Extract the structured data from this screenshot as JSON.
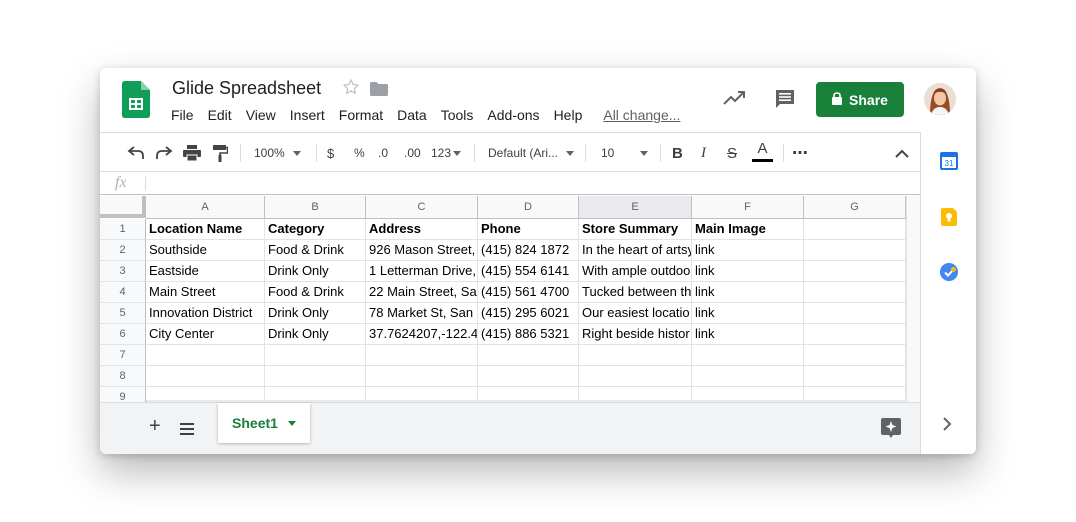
{
  "header": {
    "title": "Glide Spreadsheet",
    "share_label": "Share"
  },
  "menu": {
    "items": [
      "File",
      "Edit",
      "View",
      "Insert",
      "Format",
      "Data",
      "Tools",
      "Add-ons",
      "Help"
    ],
    "last_edit_link": "All change..."
  },
  "toolbar": {
    "zoom": "100%",
    "currency": "$",
    "percent": "%",
    "decrease_decimal": ".0",
    "increase_decimal": ".00",
    "more_formats": "123",
    "font": "Default (Ari...",
    "font_size": "10",
    "bold": "B",
    "italic": "I",
    "strike": "S",
    "text_color": "A",
    "more": "⋯"
  },
  "formula_bar": {
    "fx": "fx"
  },
  "sheet": {
    "columns": [
      "A",
      "B",
      "C",
      "D",
      "E",
      "F",
      "G"
    ],
    "selected_column": "E",
    "row_numbers": [
      "1",
      "2",
      "3",
      "4",
      "5",
      "6",
      "7",
      "8",
      "9"
    ],
    "rows": [
      [
        "Location Name",
        "Category",
        "Address",
        "Phone",
        "Store Summary",
        "Main Image",
        ""
      ],
      [
        "Southside",
        "Food & Drink",
        "926 Mason Street,",
        "(415) 824 1872",
        "In the heart of artsy",
        "link",
        ""
      ],
      [
        "Eastside",
        "Drink Only",
        "1 Letterman Drive,",
        "(415) 554 6141",
        "With ample outdoo",
        "link",
        ""
      ],
      [
        "Main Street",
        "Food & Drink",
        "22 Main Street, Sa",
        "(415) 561 4700",
        "Tucked between th",
        "link",
        ""
      ],
      [
        "Innovation District",
        "Drink Only",
        "78 Market St, San",
        "(415) 295 6021",
        "Our easiest locatio",
        "link",
        ""
      ],
      [
        "City Center",
        "Drink Only",
        "37.7624207,-122.4",
        "(415) 886 5321",
        "Right beside histor",
        "link",
        ""
      ],
      [
        "",
        "",
        "",
        "",
        "",
        "",
        ""
      ],
      [
        "",
        "",
        "",
        "",
        "",
        "",
        ""
      ],
      [
        "",
        "",
        "",
        "",
        "",
        "",
        ""
      ]
    ]
  },
  "bottom": {
    "add_sheet": "+",
    "tab_label": "Sheet1"
  },
  "side_panel": {
    "calendar_label": "31"
  },
  "colors": {
    "brand_green": "#188038",
    "calendar_blue": "#1a73e8",
    "keep_yellow": "#fbbc04",
    "tasks_blue": "#4285f4"
  }
}
